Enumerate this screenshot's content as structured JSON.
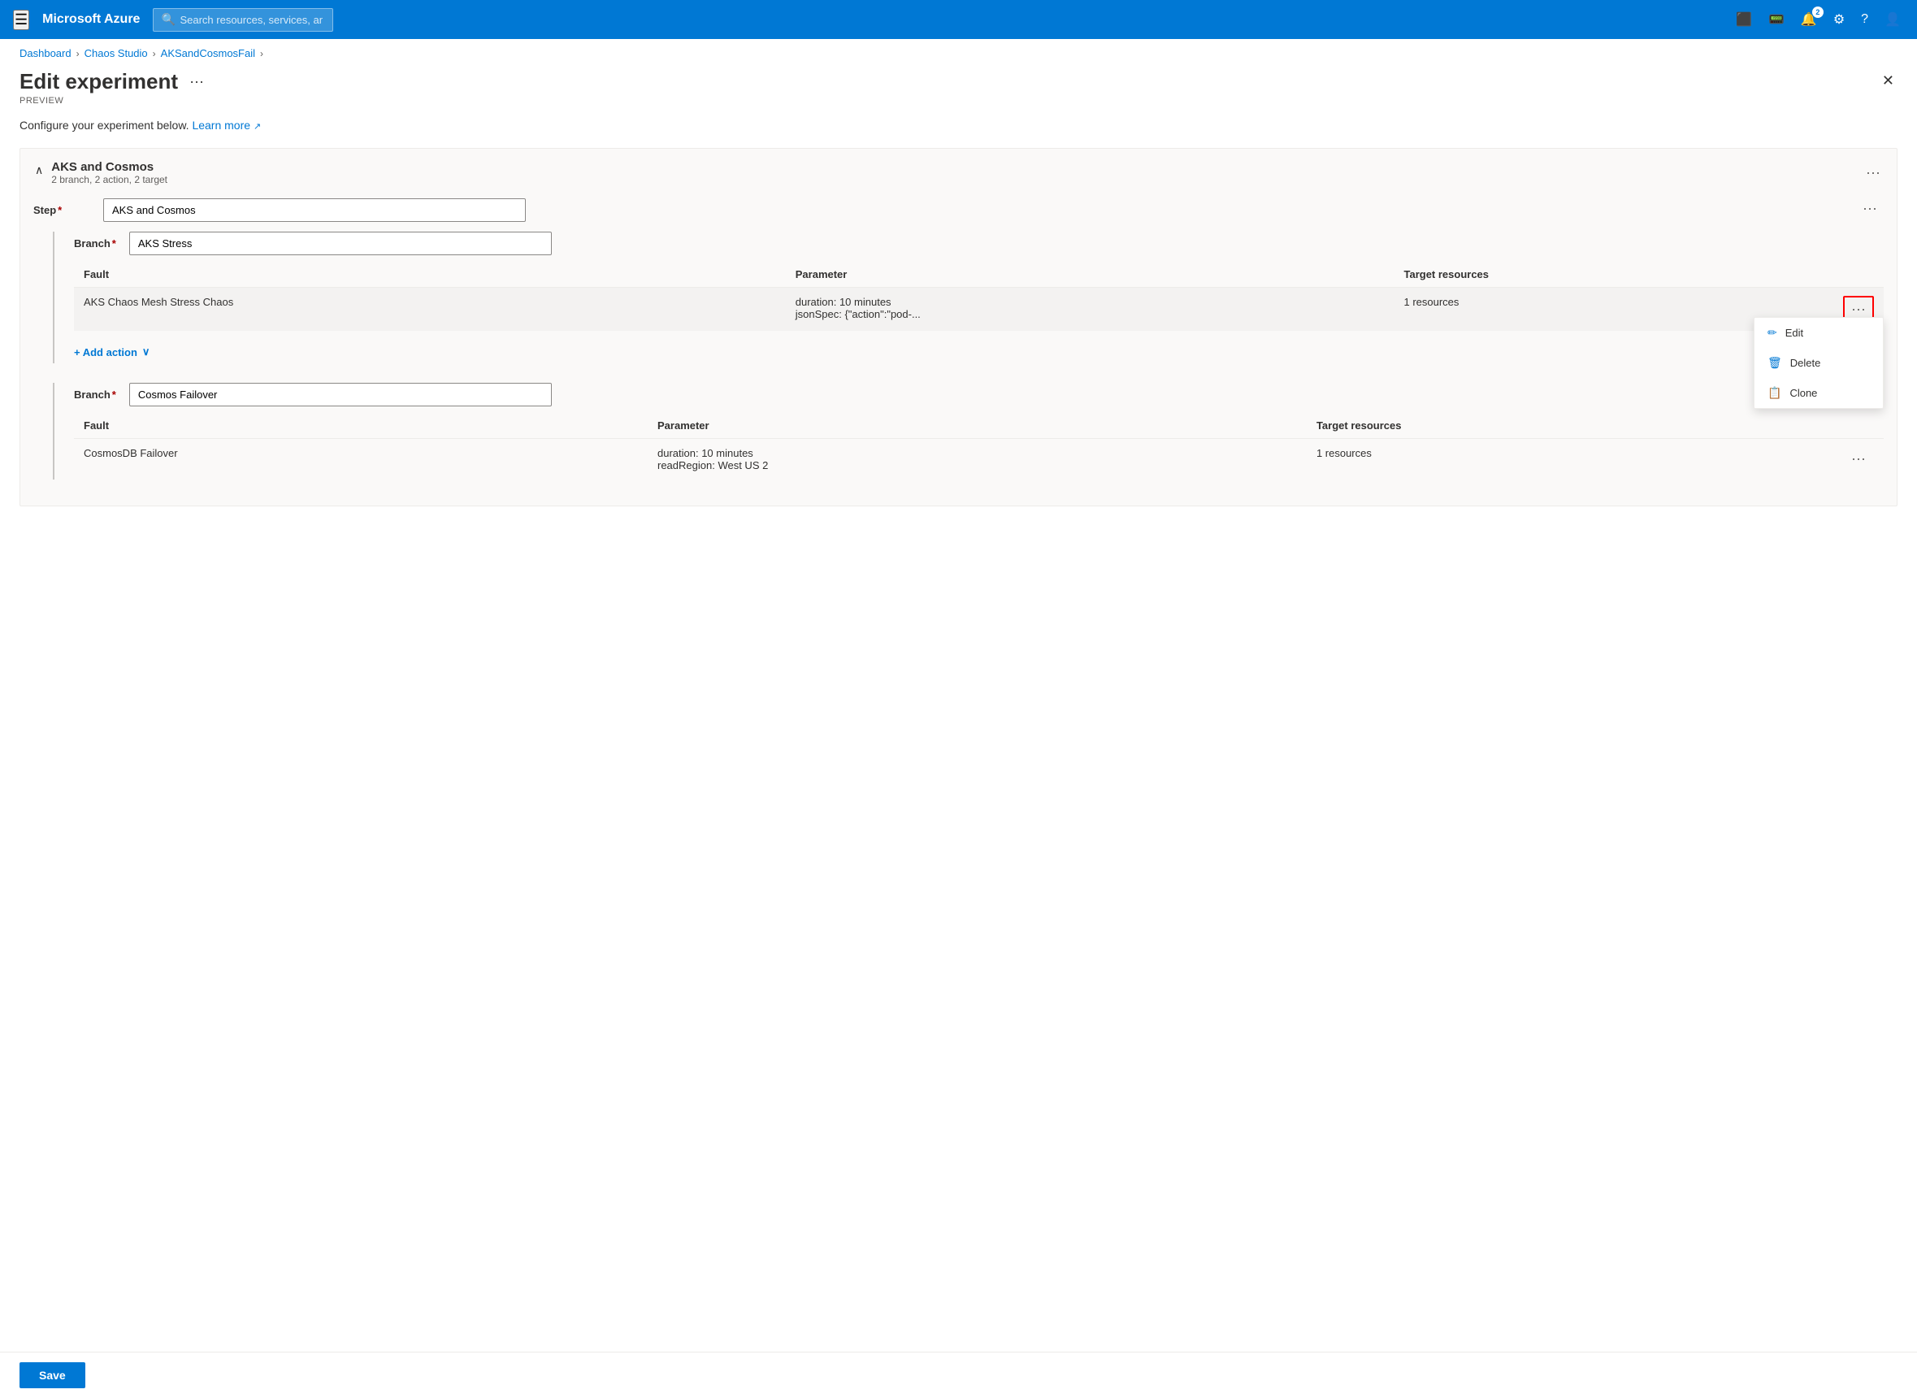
{
  "topbar": {
    "brand": "Microsoft Azure",
    "search_placeholder": "Search resources, services, and docs (G+/)",
    "notification_count": "2"
  },
  "breadcrumb": {
    "items": [
      "Dashboard",
      "Chaos Studio",
      "AKSandCosmosFail"
    ],
    "separators": [
      ">",
      ">",
      ">"
    ]
  },
  "page": {
    "title": "Edit experiment",
    "subtitle": "PREVIEW",
    "more_label": "···",
    "configure_text": "Configure your experiment below.",
    "learn_more": "Learn more"
  },
  "experiment": {
    "title": "AKS and Cosmos",
    "subtitle": "2 branch, 2 action, 2 target",
    "step_label": "Step",
    "step_required": "*",
    "step_value": "AKS and Cosmos",
    "branch1": {
      "label": "Branch",
      "required": "*",
      "value": "AKS Stress",
      "fault_col": "Fault",
      "param_col": "Parameter",
      "target_col": "Target resources",
      "fault_name": "AKS Chaos Mesh Stress Chaos",
      "fault_params": "duration: 10 minutes\njsonSpec: {\"action\":\"pod-...",
      "fault_targets": "1 resources",
      "add_action_label": "+ Add action"
    },
    "branch2": {
      "label": "Branch",
      "required": "*",
      "value": "Cosmos Failover",
      "fault_col": "Fault",
      "param_col": "Parameter",
      "target_col": "Target resources",
      "fault_name": "CosmosDB Failover",
      "fault_params": "duration: 10 minutes\nreadRegion: West US 2",
      "fault_targets": "1 resources"
    }
  },
  "dropdown": {
    "edit_label": "Edit",
    "delete_label": "Delete",
    "clone_label": "Clone"
  },
  "save_button": "Save"
}
